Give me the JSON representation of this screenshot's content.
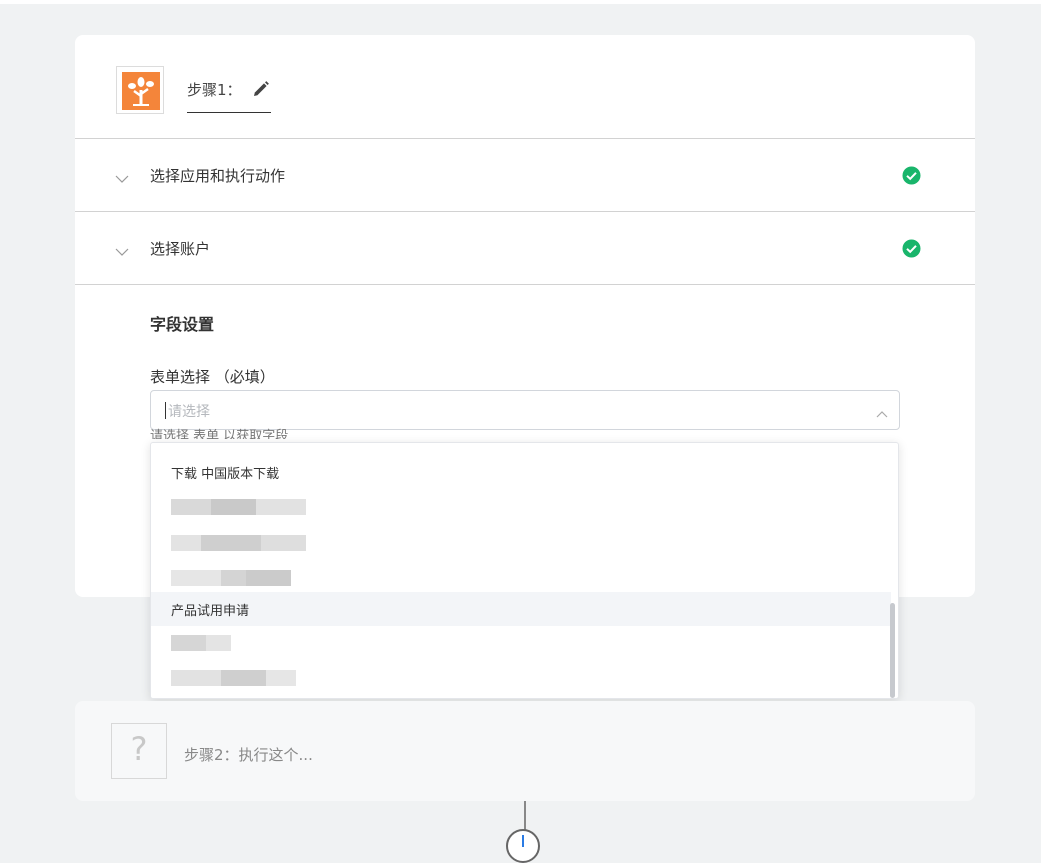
{
  "step1": {
    "title": "步骤1：",
    "app_icon": "tree-icon",
    "edit_icon": "pencil-icon",
    "accordion": [
      {
        "label": "选择应用和执行动作",
        "status_icon": "check-circle-icon"
      },
      {
        "label": "选择账户",
        "status_icon": "check-circle-icon"
      }
    ],
    "fields": {
      "section_title": "字段设置",
      "label": "表单选择 （必填）",
      "placeholder": "请选择",
      "hint": "请选择 表单 以获取字段",
      "options": [
        "下载 中国版本下载",
        "",
        "",
        "",
        "产品试用申请",
        "",
        ""
      ]
    }
  },
  "step2": {
    "title": "步骤2：执行这个..."
  },
  "colors": {
    "brand_orange": "#f4853a",
    "success_green": "#19b56b",
    "accent_blue": "#2a7be4"
  }
}
